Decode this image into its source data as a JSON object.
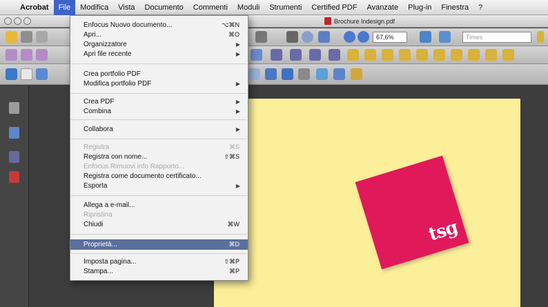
{
  "menubar": {
    "app": "Acrobat",
    "items": [
      "File",
      "Modifica",
      "Vista",
      "Documento",
      "Commenti",
      "Moduli",
      "Strumenti",
      "Certified PDF",
      "Avanzate",
      "Plug-in",
      "Finestra",
      "?"
    ]
  },
  "window": {
    "title": "Brochure Indesign.pdf"
  },
  "toolbar": {
    "zoom": "67,6%",
    "font_field": "Times"
  },
  "file_menu": {
    "items": [
      {
        "label": "Enfocus Nuovo documento...",
        "shortcut": "⌥⌘N"
      },
      {
        "label": "Apri...",
        "shortcut": "⌘O"
      },
      {
        "label": "Organizzatore",
        "shortcut": "▶"
      },
      {
        "label": "Apri file recente",
        "shortcut": "▶"
      },
      {
        "label": "Crea portfolio PDF",
        "shortcut": ""
      },
      {
        "label": "Modifica portfolio PDF",
        "shortcut": "▶"
      },
      {
        "label": "Crea PDF",
        "shortcut": "▶"
      },
      {
        "label": "Combina",
        "shortcut": "▶"
      },
      {
        "label": "Collabora",
        "shortcut": "▶"
      },
      {
        "label": "Registra",
        "shortcut": "⌘S"
      },
      {
        "label": "Registra con nome...",
        "shortcut": "⇧⌘S"
      },
      {
        "label": "Enfocus Rimuovi info Rapporto...",
        "shortcut": ""
      },
      {
        "label": "Registra come documento certificato...",
        "shortcut": ""
      },
      {
        "label": "Esporta",
        "shortcut": "▶"
      },
      {
        "label": "Allega a e-mail...",
        "shortcut": ""
      },
      {
        "label": "Ripristina",
        "shortcut": ""
      },
      {
        "label": "Chiudi",
        "shortcut": "⌘W"
      },
      {
        "label": "Proprietà...",
        "shortcut": "⌘D"
      },
      {
        "label": "Imposta pagina...",
        "shortcut": "⇧⌘P"
      },
      {
        "label": "Stampa...",
        "shortcut": "⌘P"
      }
    ]
  },
  "document": {
    "logo_text": "tsg"
  },
  "colors": {
    "accent": "#3d63c9",
    "selected": "#5a6f9c",
    "page": "#fbef9a",
    "logo": "#e0195b"
  },
  "icons": [
    "apple-icon",
    "pdf-icon",
    "pages-icon",
    "bookmark-icon",
    "attachment-icon",
    "signature-icon"
  ]
}
